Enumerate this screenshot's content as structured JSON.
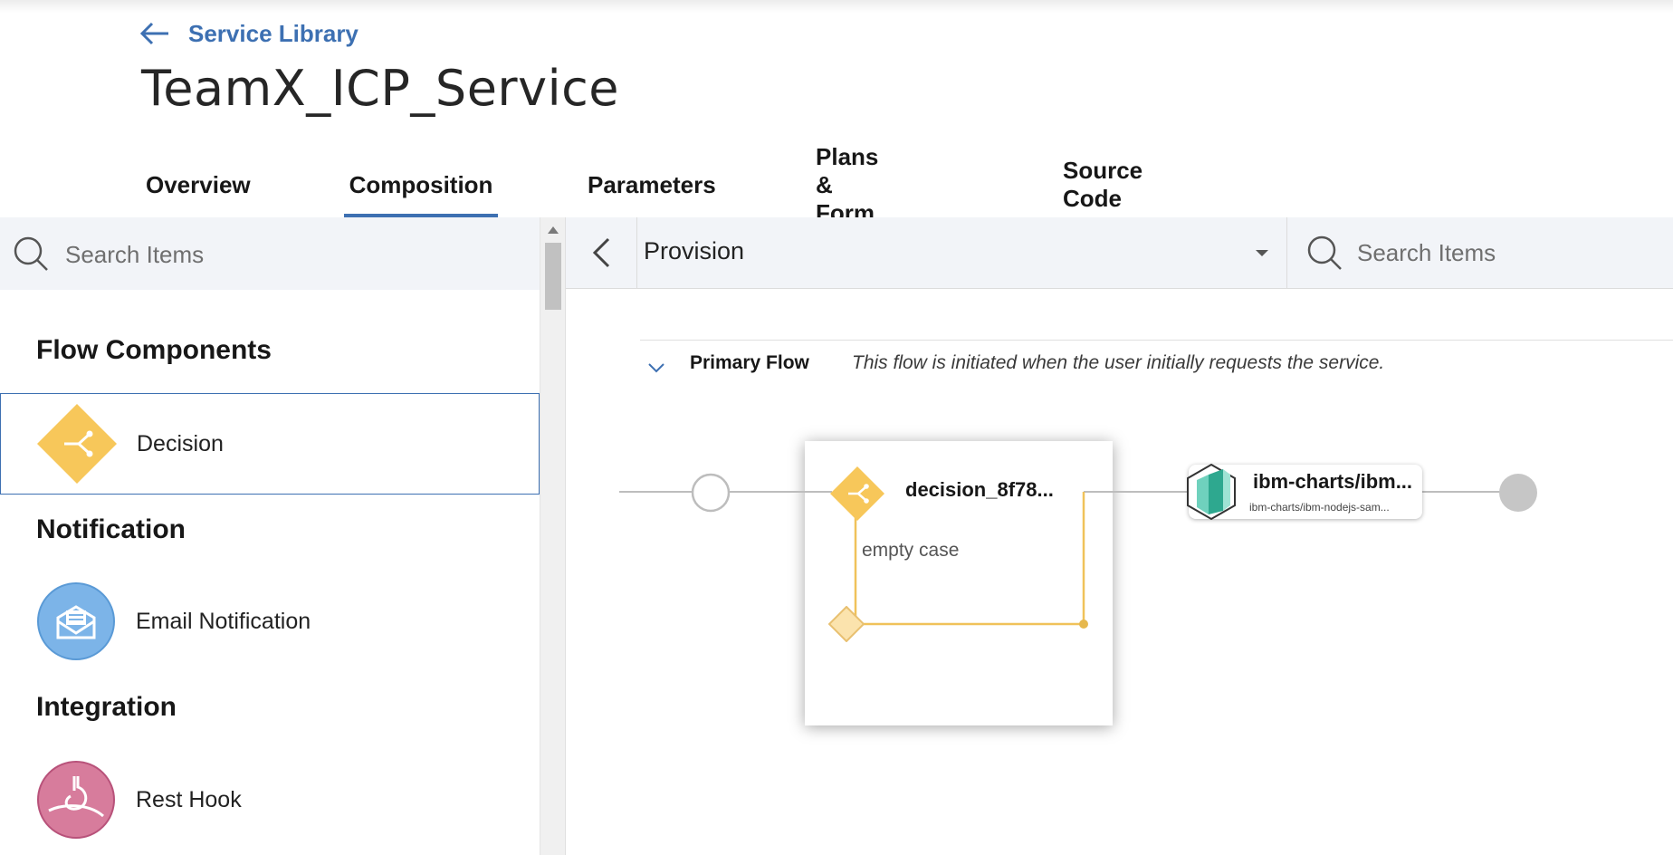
{
  "header": {
    "back_label": "Service Library",
    "title": "TeamX_ICP_Service"
  },
  "tabs": [
    {
      "label": "Overview"
    },
    {
      "label": "Composition"
    },
    {
      "label": "Parameters"
    },
    {
      "label": "Plans & Form"
    },
    {
      "label": "Source Code"
    }
  ],
  "active_tab": "Composition",
  "palette": {
    "search_placeholder": "Search Items",
    "sections": [
      {
        "title": "Flow Components",
        "items": [
          {
            "label": "Decision",
            "icon": "decision-icon"
          }
        ]
      },
      {
        "title": "Notification",
        "items": [
          {
            "label": "Email Notification",
            "icon": "email-icon"
          }
        ]
      },
      {
        "title": "Integration",
        "items": [
          {
            "label": "Rest Hook",
            "icon": "rest-hook-icon"
          }
        ]
      }
    ],
    "selected_item": "Decision"
  },
  "toolbar": {
    "action_select": "Provision",
    "search_placeholder": "Search Items"
  },
  "flow": {
    "name": "Primary Flow",
    "description": "This flow is initiated when the user initially requests the service.",
    "decision": {
      "title": "decision_8f78...",
      "case_label": "empty case"
    },
    "service": {
      "title": "ibm-charts/ibm...",
      "subtitle": "ibm-charts/ibm-nodejs-sam..."
    }
  },
  "colors": {
    "accent": "#3d70b2",
    "decision": "#f7c75a",
    "email": "#7cb4e8",
    "rest_hook": "#d77c9c",
    "service": "#39b3a0"
  }
}
